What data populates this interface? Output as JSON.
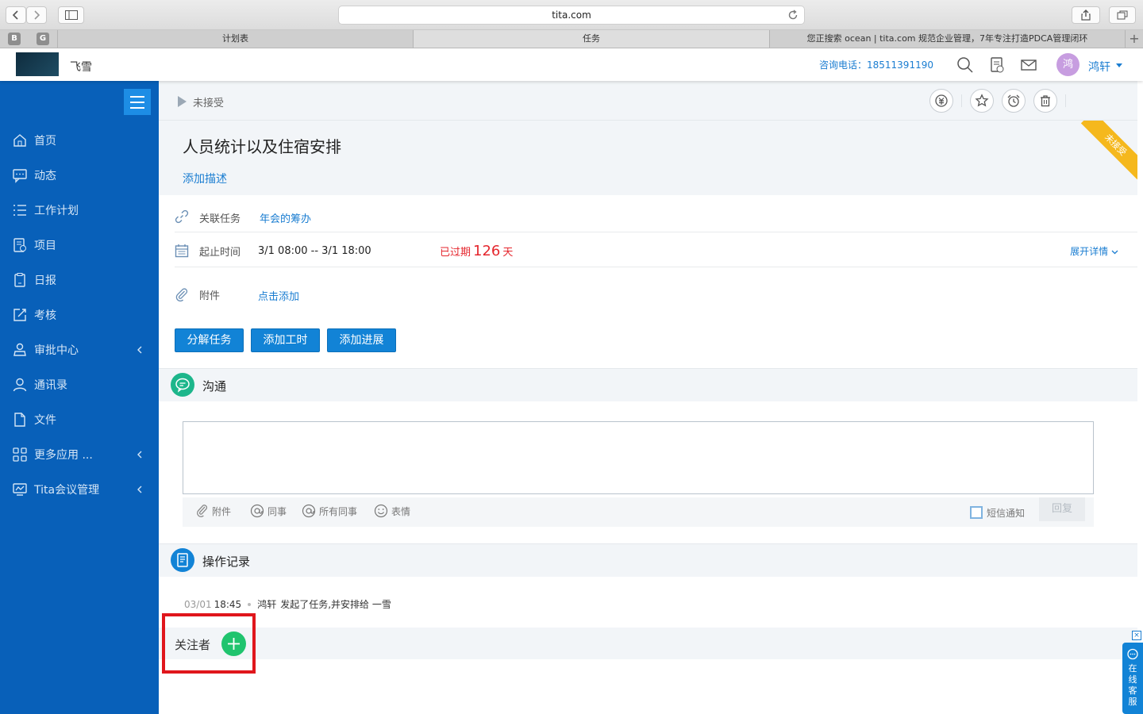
{
  "browser": {
    "address": "tita.com",
    "pinned": [
      "B",
      "G"
    ],
    "tabs": [
      {
        "label": "计划表",
        "active": false
      },
      {
        "label": "任务",
        "active": true
      },
      {
        "label": "您正搜索 ocean | tita.com 规范企业管理，7年专注打造PDCA管理闭环",
        "active": false
      }
    ],
    "new_tab": "+"
  },
  "header": {
    "company": "飞雪",
    "hotline": "咨询电话：18511391190",
    "avatar_text": "鸿",
    "username": "鸿轩",
    "icons": [
      "search-icon",
      "document-icon",
      "mail-icon"
    ]
  },
  "sidebar": {
    "items": [
      {
        "label": "首页",
        "icon": "home-icon"
      },
      {
        "label": "动态",
        "icon": "chat-icon"
      },
      {
        "label": "工作计划",
        "icon": "list-icon"
      },
      {
        "label": "项目",
        "icon": "project-icon"
      },
      {
        "label": "日报",
        "icon": "report-icon"
      },
      {
        "label": "考核",
        "icon": "edit-icon"
      },
      {
        "label": "审批中心",
        "icon": "approval-icon",
        "expandable": true
      },
      {
        "label": "通讯录",
        "icon": "contacts-icon"
      },
      {
        "label": "文件",
        "icon": "file-icon"
      },
      {
        "label": "更多应用 ...",
        "icon": "apps-icon",
        "expandable": true
      },
      {
        "label": "Tita会议管理",
        "icon": "meeting-icon",
        "expandable": true
      }
    ]
  },
  "task": {
    "status": "未接受",
    "ribbon": "未接受",
    "title": "人员统计以及住宿安排",
    "add_description": "添加描述",
    "related_label": "关联任务",
    "related_value": "年会的筹办",
    "time_label": "起止时间",
    "time_value": "3/1 08:00 -- 3/1 18:00",
    "overdue_prefix": "已过期",
    "overdue_days": "126",
    "overdue_suffix": "天",
    "expand_label": "展开详情",
    "attachment_label": "附件",
    "attachment_action": "点击添加",
    "buttons": {
      "split": "分解任务",
      "add_hours": "添加工时",
      "add_progress": "添加进展"
    },
    "actions": [
      "coin-icon",
      "star-icon",
      "alarm-icon",
      "trash-icon"
    ]
  },
  "communication": {
    "title": "沟通",
    "tools": {
      "attachment": "附件",
      "colleague": "同事",
      "all_colleagues": "所有同事",
      "emoji": "表情"
    },
    "sms_label": "短信通知",
    "reply_label": "回复"
  },
  "log": {
    "title": "操作记录",
    "entries": [
      {
        "date": "03/01",
        "time": "18:45",
        "user": "鸿轩",
        "text": "发起了任务,并安排给 一雪"
      }
    ]
  },
  "followers": {
    "label": "关注者"
  },
  "customer_service": {
    "label": "在线客服",
    "close": "×"
  },
  "colors": {
    "sidebar": "#0860b9",
    "accent": "#1a7dd1",
    "button": "#1283d6",
    "overdue": "#e5262d",
    "add": "#20c46e",
    "highlight": "#e0161c"
  }
}
